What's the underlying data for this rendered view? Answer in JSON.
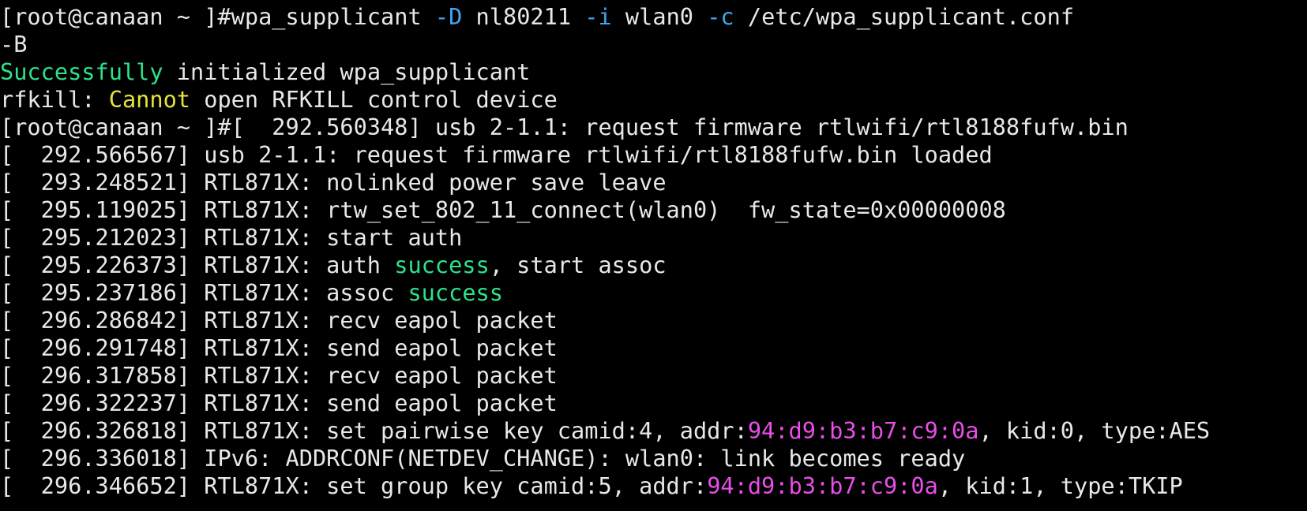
{
  "colors": {
    "background": "#000000",
    "foreground": "#e8e8e8",
    "success_green": "#2ee28a",
    "warning_yellow": "#e7e33a",
    "option_blue": "#3fa6f2",
    "address_magenta": "#e84ee8"
  },
  "lines": [
    {
      "segments": [
        {
          "text": "[root@canaan ~ ]#wpa_supplicant ",
          "color": "plain"
        },
        {
          "text": "-D",
          "color": "blue"
        },
        {
          "text": " nl80211 ",
          "color": "plain"
        },
        {
          "text": "-i",
          "color": "blue"
        },
        {
          "text": " wlan0 ",
          "color": "plain"
        },
        {
          "text": "-c",
          "color": "blue"
        },
        {
          "text": " /etc/wpa_supplicant.conf",
          "color": "plain"
        }
      ]
    },
    {
      "segments": [
        {
          "text": "-B",
          "color": "plain"
        }
      ]
    },
    {
      "segments": [
        {
          "text": "Successfully",
          "color": "green"
        },
        {
          "text": " initialized wpa_supplicant",
          "color": "plain"
        }
      ]
    },
    {
      "segments": [
        {
          "text": "rfkill: ",
          "color": "plain"
        },
        {
          "text": "Cannot",
          "color": "yellow"
        },
        {
          "text": " open RFKILL control device",
          "color": "plain"
        }
      ]
    },
    {
      "segments": [
        {
          "text": "[root@canaan ~ ]#[  292.560348] usb 2-1.1: request firmware rtlwifi/rtl8188fufw.bin",
          "color": "plain"
        }
      ]
    },
    {
      "segments": [
        {
          "text": "[  292.566567] usb 2-1.1: request firmware rtlwifi/rtl8188fufw.bin loaded",
          "color": "plain"
        }
      ]
    },
    {
      "segments": [
        {
          "text": "[  293.248521] RTL871X: nolinked power save leave",
          "color": "plain"
        }
      ]
    },
    {
      "segments": [
        {
          "text": "[  295.119025] RTL871X: rtw_set_802_11_connect(wlan0)  fw_state=0x00000008",
          "color": "plain"
        }
      ]
    },
    {
      "segments": [
        {
          "text": "[  295.212023] RTL871X: start auth",
          "color": "plain"
        }
      ]
    },
    {
      "segments": [
        {
          "text": "[  295.226373] RTL871X: auth ",
          "color": "plain"
        },
        {
          "text": "success",
          "color": "green"
        },
        {
          "text": ", start assoc",
          "color": "plain"
        }
      ]
    },
    {
      "segments": [
        {
          "text": "[  295.237186] RTL871X: assoc ",
          "color": "plain"
        },
        {
          "text": "success",
          "color": "green"
        }
      ]
    },
    {
      "segments": [
        {
          "text": "[  296.286842] RTL871X: recv eapol packet",
          "color": "plain"
        }
      ]
    },
    {
      "segments": [
        {
          "text": "[  296.291748] RTL871X: send eapol packet",
          "color": "plain"
        }
      ]
    },
    {
      "segments": [
        {
          "text": "[  296.317858] RTL871X: recv eapol packet",
          "color": "plain"
        }
      ]
    },
    {
      "segments": [
        {
          "text": "[  296.322237] RTL871X: send eapol packet",
          "color": "plain"
        }
      ]
    },
    {
      "segments": [
        {
          "text": "[  296.326818] RTL871X: set pairwise key camid:4, addr:",
          "color": "plain"
        },
        {
          "text": "94:d9:b3:b7:c9:0a",
          "color": "magenta"
        },
        {
          "text": ", kid:0, type:AES",
          "color": "plain"
        }
      ]
    },
    {
      "segments": [
        {
          "text": "[  296.336018] IPv6: ADDRCONF(NETDEV_CHANGE): wlan0: link becomes ready",
          "color": "plain"
        }
      ]
    },
    {
      "segments": [
        {
          "text": "[  296.346652] RTL871X: set group key camid:5, addr:",
          "color": "plain"
        },
        {
          "text": "94:d9:b3:b7:c9:0a",
          "color": "magenta"
        },
        {
          "text": ", kid:1, type:TKIP",
          "color": "plain"
        }
      ]
    }
  ]
}
